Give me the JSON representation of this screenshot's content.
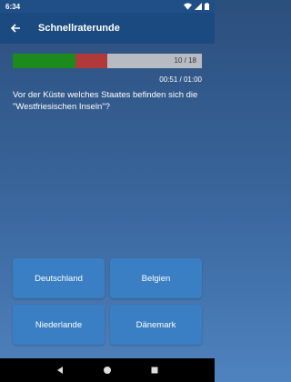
{
  "status_bar": {
    "time": "6:34"
  },
  "app_bar": {
    "title": "Schnellraterunde",
    "back_icon": "arrow-left-icon"
  },
  "progress": {
    "current": 10,
    "total": 18,
    "correct_fraction": 0.33,
    "wrong_fraction": 0.17,
    "count_text": "10  /  18",
    "colors": {
      "correct": "#1c8a1c",
      "wrong": "#b03a3a",
      "remaining": "#b8bcc2"
    }
  },
  "timer": {
    "text": "00:51  /  01:00"
  },
  "question": {
    "text": "Vor der Küste welches Staates befinden sich die \"Westfriesischen Inseln\"?"
  },
  "answers": [
    {
      "label": "Deutschland"
    },
    {
      "label": "Belgien"
    },
    {
      "label": "Niederlande"
    },
    {
      "label": "Dänemark"
    }
  ],
  "nav_bar": {
    "icons": [
      "back-triangle-icon",
      "home-circle-icon",
      "recents-square-icon"
    ]
  }
}
